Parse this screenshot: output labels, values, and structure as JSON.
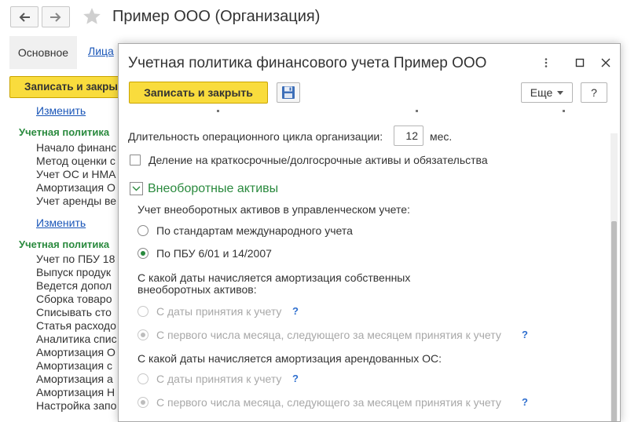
{
  "background": {
    "title": "Пример ООО (Организация)",
    "tabs": {
      "main": "Основное",
      "link": "Лица"
    },
    "save_close": "Записать и закрыть",
    "change_link_1": "Изменить",
    "change_link_2": "Изменить",
    "section_1": "Учетная политика",
    "section_1_items": [
      "Начало финанс",
      "Метод оценки с",
      "Учет ОС и НМА",
      "Амортизация О",
      "Учет аренды ве"
    ],
    "section_2": "Учетная политика",
    "section_2_items": [
      "Учет по ПБУ 18",
      "Выпуск продук",
      "Ведется допол",
      "Сборка товаро",
      "Списывать сто",
      "Статья расходо",
      "Аналитика спис",
      "Амортизация О",
      "Амортизация с",
      "Амортизация а",
      "Амортизация Н",
      "Настройка запо"
    ]
  },
  "modal": {
    "title": "Учетная политика финансового учета Пример ООО",
    "save_close": "Записать и закрыть",
    "more": "Еще",
    "help": "?",
    "cycle_label": "Длительность операционного цикла организации:",
    "cycle_value": "12",
    "cycle_unit": "мес.",
    "split_assets_label": "Деление на краткосрочные/долгосрочные активы и обязательства",
    "group_title": "Внеоборотные активы",
    "mgmt_label": "Учет внеоборотных активов в управленческом учете:",
    "mgmt_options": [
      "По стандартам международного учета",
      "По ПБУ 6/01 и 14/2007"
    ],
    "own_depr_label_line1": "С какой даты начисляется амортизация собственных",
    "own_depr_label_line2": "внеоборотных активов:",
    "own_depr_options": [
      "С даты принятия к учету",
      "С первого числа месяца, следующего за месяцем принятия к учету"
    ],
    "lease_depr_label": "С какой даты начисляется амортизация арендованных ОС:",
    "lease_depr_options": [
      "С даты принятия к учету",
      "С первого числа месяца, следующего за месяцем принятия к учету"
    ],
    "qmark": "?"
  },
  "colors": {
    "accent_yellow": "#f9dc3d",
    "green": "#2a8a3e",
    "link_blue": "#1a56b8"
  }
}
